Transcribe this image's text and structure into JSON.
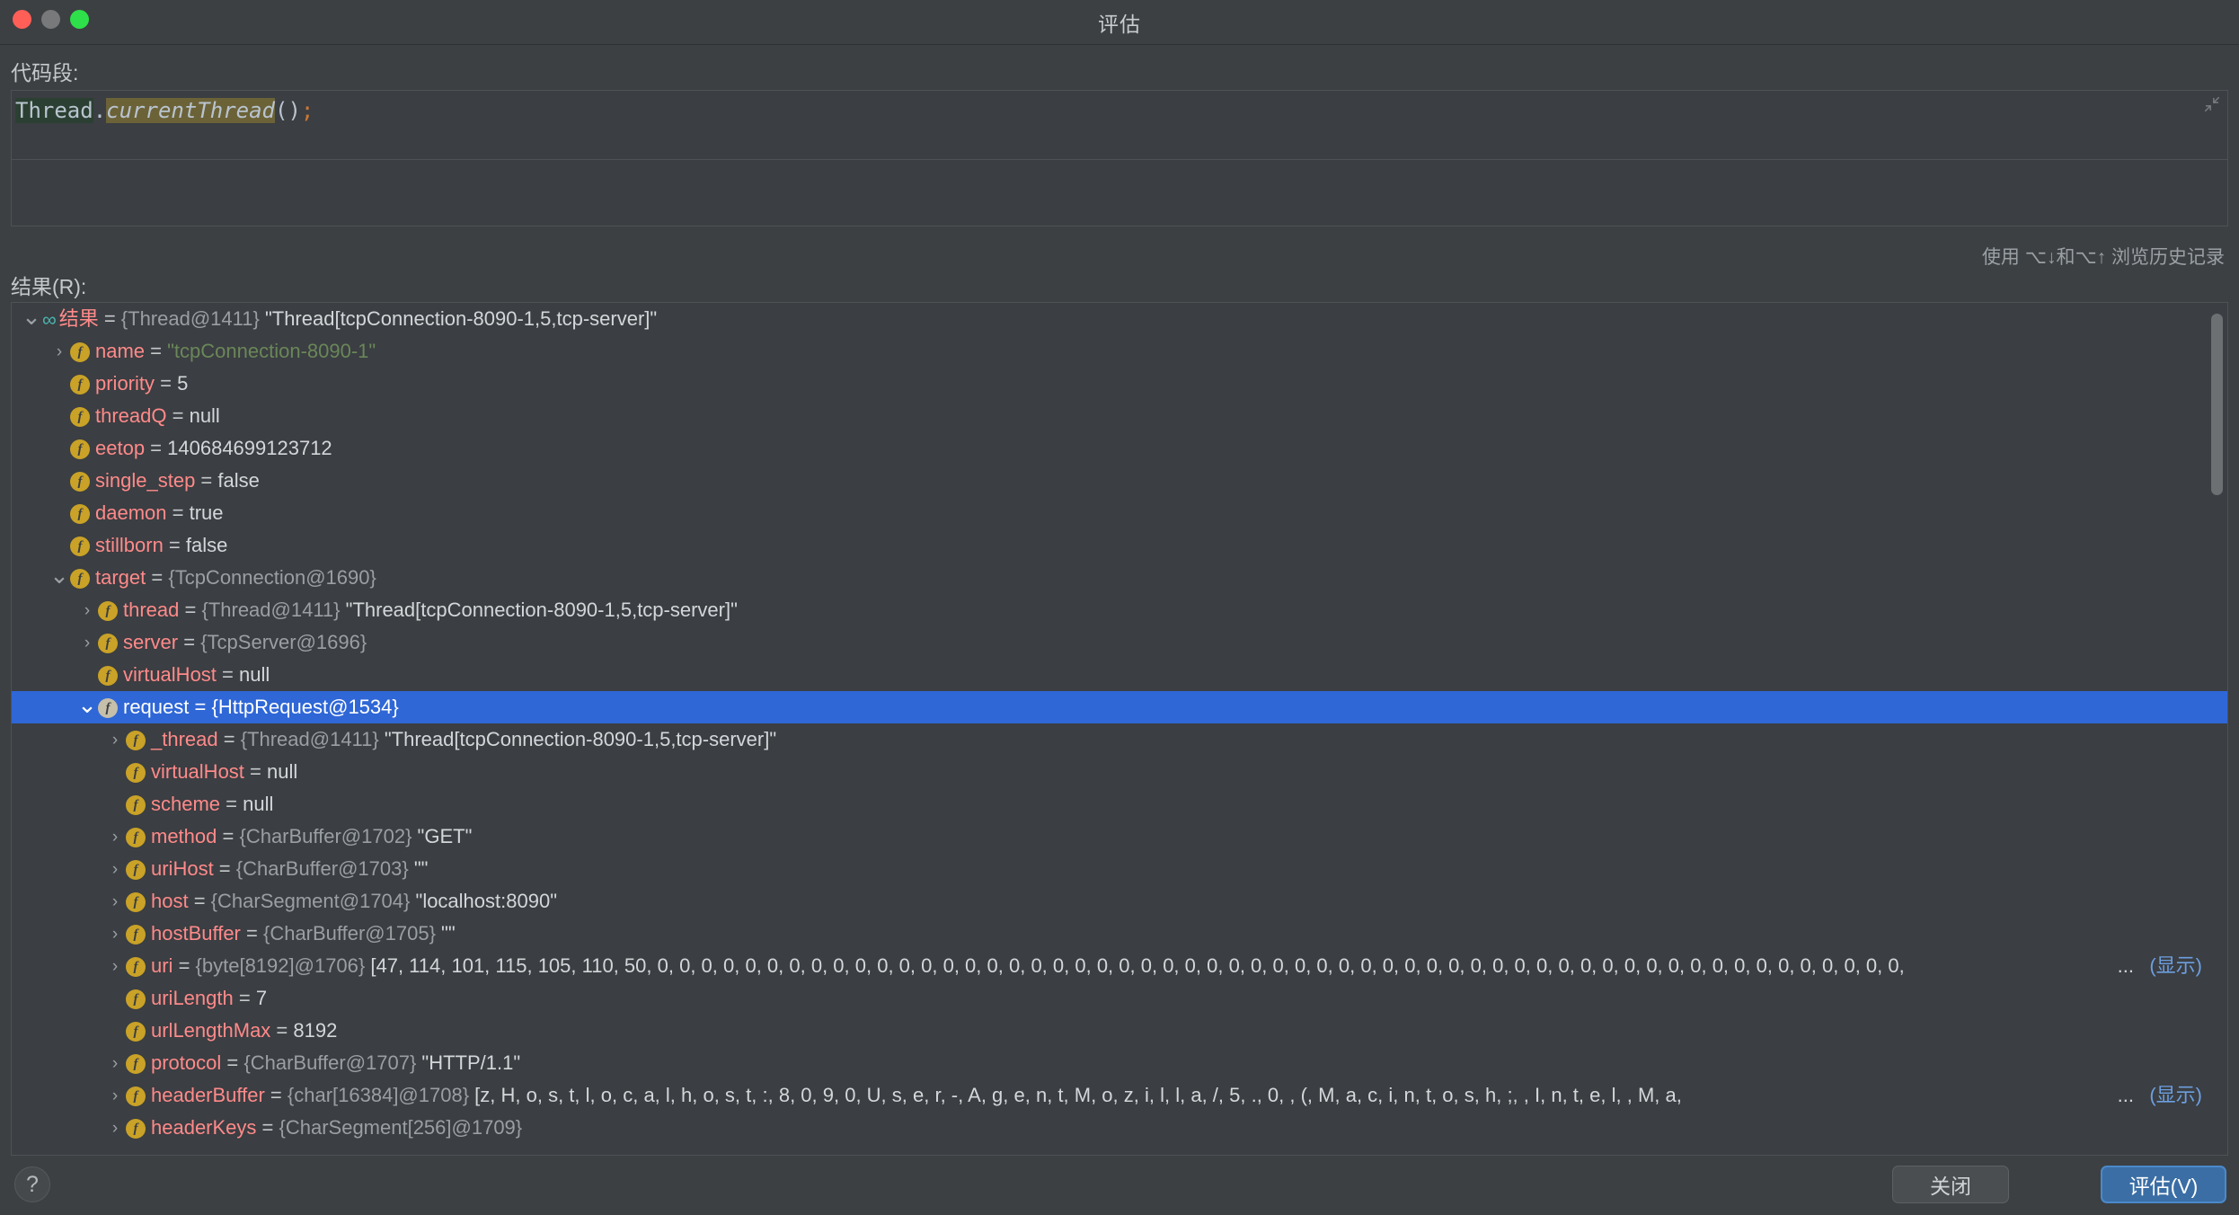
{
  "window": {
    "title": "评估",
    "traffic_lights": [
      "close-dot",
      "minimize-dot",
      "zoom-dot"
    ]
  },
  "code_section": {
    "label": "代码段:",
    "tokens": {
      "class": "Thread",
      "dot": ".",
      "method": "currentThread",
      "parens": "()",
      "semicolon": ";"
    },
    "full_text": "Thread.currentThread();",
    "collapse_icon": "collapse-icon",
    "history_hint": "使用 ⌥↓和⌥↑ 浏览历史记录"
  },
  "result_section": {
    "label": "结果(R):",
    "rows": [
      {
        "indent": 0,
        "arrow": "down",
        "icon": "oo",
        "name": "结果",
        "eq": "=",
        "type": "{Thread@1411}",
        "value": "\"Thread[tcpConnection-8090-1,5,tcp-server]\"",
        "value_kind": "plain",
        "selected": false
      },
      {
        "indent": 1,
        "arrow": "right",
        "icon": "f",
        "name": "name",
        "eq": "=",
        "type": "",
        "value": "\"tcpConnection-8090-1\"",
        "value_kind": "string",
        "selected": false
      },
      {
        "indent": 1,
        "arrow": "none",
        "icon": "f",
        "name": "priority",
        "eq": "=",
        "type": "",
        "value": "5",
        "value_kind": "plain",
        "selected": false
      },
      {
        "indent": 1,
        "arrow": "none",
        "icon": "f",
        "name": "threadQ",
        "eq": "=",
        "type": "",
        "value": "null",
        "value_kind": "plain",
        "selected": false
      },
      {
        "indent": 1,
        "arrow": "none",
        "icon": "f",
        "name": "eetop",
        "eq": "=",
        "type": "",
        "value": "140684699123712",
        "value_kind": "plain",
        "selected": false
      },
      {
        "indent": 1,
        "arrow": "none",
        "icon": "f",
        "name": "single_step",
        "eq": "=",
        "type": "",
        "value": "false",
        "value_kind": "plain",
        "selected": false
      },
      {
        "indent": 1,
        "arrow": "none",
        "icon": "f",
        "name": "daemon",
        "eq": "=",
        "type": "",
        "value": "true",
        "value_kind": "plain",
        "selected": false
      },
      {
        "indent": 1,
        "arrow": "none",
        "icon": "f",
        "name": "stillborn",
        "eq": "=",
        "type": "",
        "value": "false",
        "value_kind": "plain",
        "selected": false
      },
      {
        "indent": 1,
        "arrow": "down",
        "icon": "f",
        "name": "target",
        "eq": "=",
        "type": "{TcpConnection@1690}",
        "value": "",
        "value_kind": "plain",
        "selected": false
      },
      {
        "indent": 2,
        "arrow": "right",
        "icon": "f",
        "name": "thread",
        "eq": "=",
        "type": "{Thread@1411}",
        "value": "\"Thread[tcpConnection-8090-1,5,tcp-server]\"",
        "value_kind": "plain",
        "selected": false
      },
      {
        "indent": 2,
        "arrow": "right",
        "icon": "f",
        "name": "server",
        "eq": "=",
        "type": "{TcpServer@1696}",
        "value": "",
        "value_kind": "plain",
        "selected": false
      },
      {
        "indent": 2,
        "arrow": "none",
        "icon": "f",
        "name": "virtualHost",
        "eq": "=",
        "type": "",
        "value": "null",
        "value_kind": "plain",
        "selected": false
      },
      {
        "indent": 2,
        "arrow": "down",
        "icon": "f",
        "name": "request",
        "eq": "=",
        "type": "{HttpRequest@1534}",
        "value": "",
        "value_kind": "plain",
        "selected": true
      },
      {
        "indent": 3,
        "arrow": "right",
        "icon": "f",
        "name": "_thread",
        "eq": "=",
        "type": "{Thread@1411}",
        "value": "\"Thread[tcpConnection-8090-1,5,tcp-server]\"",
        "value_kind": "plain",
        "selected": false
      },
      {
        "indent": 3,
        "arrow": "none",
        "icon": "f",
        "name": "virtualHost",
        "eq": "=",
        "type": "",
        "value": "null",
        "value_kind": "plain",
        "selected": false
      },
      {
        "indent": 3,
        "arrow": "none",
        "icon": "f",
        "name": "scheme",
        "eq": "=",
        "type": "",
        "value": "null",
        "value_kind": "plain",
        "selected": false
      },
      {
        "indent": 3,
        "arrow": "right",
        "icon": "f",
        "name": "method",
        "eq": "=",
        "type": "{CharBuffer@1702}",
        "value": "\"GET\"",
        "value_kind": "plain",
        "selected": false
      },
      {
        "indent": 3,
        "arrow": "right",
        "icon": "f",
        "name": "uriHost",
        "eq": "=",
        "type": "{CharBuffer@1703}",
        "value": "\"\"",
        "value_kind": "plain",
        "selected": false
      },
      {
        "indent": 3,
        "arrow": "right",
        "icon": "f",
        "name": "host",
        "eq": "=",
        "type": "{CharSegment@1704}",
        "value": "\"localhost:8090\"",
        "value_kind": "plain",
        "selected": false
      },
      {
        "indent": 3,
        "arrow": "right",
        "icon": "f",
        "name": "hostBuffer",
        "eq": "=",
        "type": "{CharBuffer@1705}",
        "value": "\"\"",
        "value_kind": "plain",
        "selected": false
      },
      {
        "indent": 3,
        "arrow": "right",
        "icon": "f",
        "name": "uri",
        "eq": "=",
        "type": "{byte[8192]@1706}",
        "value": "[47, 114, 101, 115, 105, 110, 50, 0, 0, 0, 0, 0, 0, 0, 0, 0, 0, 0, 0, 0, 0, 0, 0, 0, 0, 0, 0, 0, 0, 0, 0, 0, 0, 0, 0, 0, 0, 0, 0, 0, 0, 0, 0, 0, 0, 0, 0, 0, 0, 0, 0, 0, 0, 0, 0, 0, 0, 0, 0, 0, 0, 0, 0, 0,",
        "value_kind": "plain",
        "ellipsis": "...",
        "show_link": "(显示)",
        "selected": false
      },
      {
        "indent": 3,
        "arrow": "none",
        "icon": "f",
        "name": "uriLength",
        "eq": "=",
        "type": "",
        "value": "7",
        "value_kind": "plain",
        "selected": false
      },
      {
        "indent": 3,
        "arrow": "none",
        "icon": "f",
        "name": "urlLengthMax",
        "eq": "=",
        "type": "",
        "value": "8192",
        "value_kind": "plain",
        "selected": false
      },
      {
        "indent": 3,
        "arrow": "right",
        "icon": "f",
        "name": "protocol",
        "eq": "=",
        "type": "{CharBuffer@1707}",
        "value": "\"HTTP/1.1\"",
        "value_kind": "plain",
        "selected": false
      },
      {
        "indent": 3,
        "arrow": "right",
        "icon": "f",
        "name": "headerBuffer",
        "eq": "=",
        "type": "{char[16384]@1708}",
        "value": "[z, H, o, s, t, l, o, c, a, l, h, o, s, t, :, 8, 0, 9, 0, U, s, e, r, -, A, g, e, n, t, M, o, z, i, l, l, a, /, 5, ., 0,  , (, M, a, c, i, n, t, o, s, h, ;,  , I, n, t, e, l,  , M, a,",
        "value_kind": "plain",
        "ellipsis": "...",
        "show_link": "(显示)",
        "selected": false
      },
      {
        "indent": 3,
        "arrow": "right",
        "icon": "f",
        "name": "headerKeys",
        "eq": "=",
        "type": "{CharSegment[256]@1709}",
        "value": "",
        "value_kind": "plain",
        "selected": false
      }
    ],
    "scrollbar": {
      "name": "vertical-scrollbar"
    }
  },
  "footer": {
    "help_label": "?",
    "close_label": "关闭",
    "evaluate_label": "评估(V)"
  },
  "colors": {
    "window_bg": "#3c4043",
    "panel_bg": "#3b3e42",
    "selection_blue": "#2f67d6",
    "accent_button": "#3a6ea5",
    "field_name": "#ff8a8a",
    "type_gray": "#9a9fa3",
    "string_green": "#6a8759",
    "link_blue": "#6c9fe0",
    "icon_gold": "#c9a227",
    "oo_teal": "#4bb4b0"
  }
}
